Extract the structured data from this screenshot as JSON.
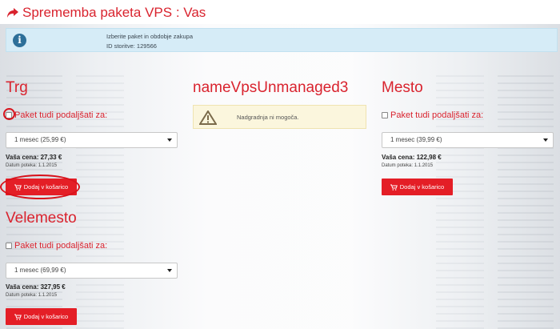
{
  "header": {
    "title": "Sprememba paketa VPS : Vas"
  },
  "info": {
    "line1": "Izberite paket in obdobje zakupa",
    "line2": "ID storitve: 129566"
  },
  "packages": {
    "trg": {
      "title": "Trg",
      "extend_label": "Paket tudi podaljšati za:",
      "period": "1 mesec  (25,99 €)",
      "price_label": "Vaša cena:",
      "price": "27,33 €",
      "expiry": "Datum poteka: 1.1.2015",
      "button": "Dodaj v košarico"
    },
    "unmanaged": {
      "title": "nameVpsUnmanaged3",
      "warning": "Nadgradnja ni mogoča."
    },
    "mesto": {
      "title": "Mesto",
      "extend_label": "Paket tudi podaljšati za:",
      "period": "1 mesec  (39,99 €)",
      "price_label": "Vaša cena:",
      "price": "122,98 €",
      "expiry": "Datum poteka: 1.1.2015",
      "button": "Dodaj v košarico"
    },
    "velemesto": {
      "title": "Velemesto",
      "extend_label": "Paket tudi podaljšati za:",
      "period": "1 mesec  (69,99 €)",
      "price_label": "Vaša cena:",
      "price": "327,95 €",
      "expiry": "Datum poteka: 1.1.2015",
      "button": "Dodaj v košarico"
    }
  },
  "colors": {
    "accent": "#d9232e",
    "button": "#e41e26",
    "info_bg": "#d6ecf7",
    "warn_bg": "#fbf6dd"
  },
  "icons": {
    "title": "share-arrow-icon",
    "info": "info-icon",
    "warning": "warning-triangle-icon",
    "cart": "cart-icon"
  }
}
